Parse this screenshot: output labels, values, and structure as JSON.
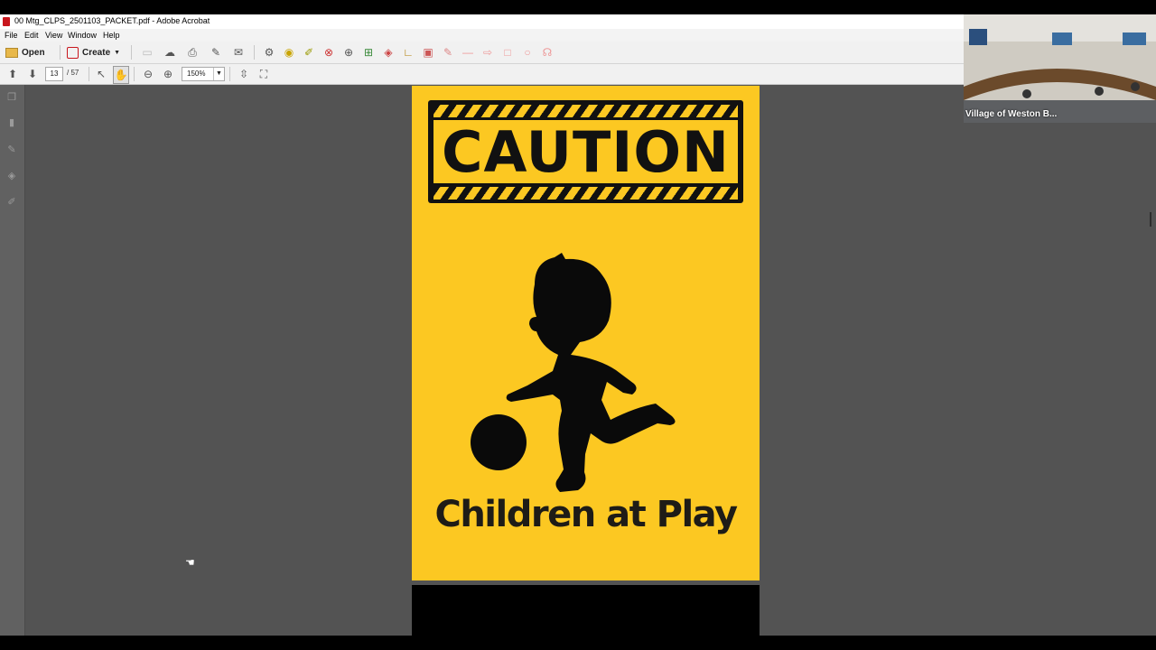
{
  "window": {
    "title": "00 Mtg_CLPS_2501103_PACKET.pdf - Adobe Acrobat"
  },
  "menu": [
    "File",
    "Edit",
    "View",
    "Window",
    "Help"
  ],
  "toolbar": {
    "open_label": "Open",
    "create_label": "Create"
  },
  "navigation": {
    "current_page": "13",
    "total_pages": "/ 57",
    "zoom": "150%"
  },
  "document": {
    "sign_heading": "CAUTION",
    "sign_caption": "Children at Play"
  },
  "video": {
    "participant_label": "Village of Weston B..."
  },
  "colors": {
    "sign_yellow": "#fcc822",
    "sign_black": "#111111",
    "canvas_gray": "#535353"
  }
}
